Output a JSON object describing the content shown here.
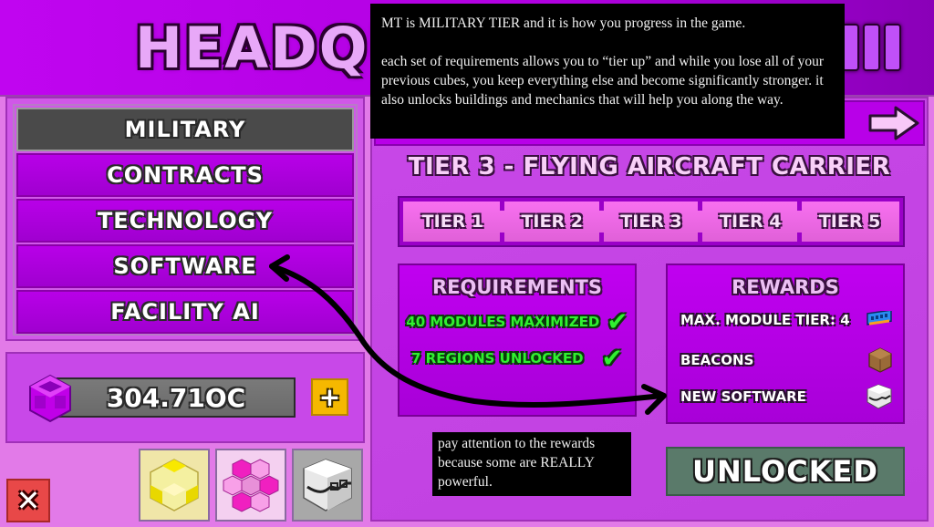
{
  "header": {
    "title": "HEADQUARTERS",
    "title_suffix_bars": 3
  },
  "sidebar": {
    "items": [
      {
        "label": "MILITARY",
        "active": true
      },
      {
        "label": "CONTRACTS",
        "active": false
      },
      {
        "label": "TECHNOLOGY",
        "active": false
      },
      {
        "label": "SOFTWARE",
        "active": false
      },
      {
        "label": "FACILITY AI",
        "active": false
      }
    ]
  },
  "currency": {
    "icon": "purple-cube-icon",
    "value": "304.71OC",
    "add_label": "+"
  },
  "shop_buttons": [
    {
      "icon": "yellow-cube-cluster-icon",
      "bg": "#f0e6a8"
    },
    {
      "icon": "pink-hex-cluster-icon",
      "bg": "#f4d0f0"
    },
    {
      "icon": "software-cube-icon",
      "bg": "#a8a8a8"
    }
  ],
  "close_label": "✕",
  "main": {
    "tier_title": "TIER 3 - FLYING AIRCRAFT CARRIER",
    "tiers": [
      "TIER 1",
      "TIER 2",
      "TIER 3",
      "TIER 4",
      "TIER 5"
    ],
    "requirements": {
      "title": "REQUIREMENTS",
      "items": [
        {
          "label": "40 MODULES MAXIMIZED",
          "met": true
        },
        {
          "label": "7 REGIONS UNLOCKED",
          "met": true
        }
      ]
    },
    "rewards": {
      "title": "REWARDS",
      "items": [
        {
          "label": "MAX. MODULE TIER: 4",
          "icon": "ram-module-icon"
        },
        {
          "label": "BEACONS",
          "icon": "crate-icon"
        },
        {
          "label": "NEW SOFTWARE",
          "icon": "software-cube-icon"
        }
      ]
    },
    "status_button": "UNLOCKED"
  },
  "annotations": {
    "top_paragraphs": [
      "MT is MILITARY TIER and it is how you progress in the game.",
      "each set of  requirements allows you to “tier up” and while you lose all of  your previous cubes, you keep everything else and become significantly stronger. it also unlocks buildings and mechanics that will help you along the way."
    ],
    "bottom": "pay attention to the rewards because some are REALLY powerful."
  },
  "colors": {
    "accent": "#b800e8",
    "requirement_met": "#30f030",
    "unlocked": "#5a7a6a",
    "plus": "#f5b800",
    "close": "#e84848"
  }
}
